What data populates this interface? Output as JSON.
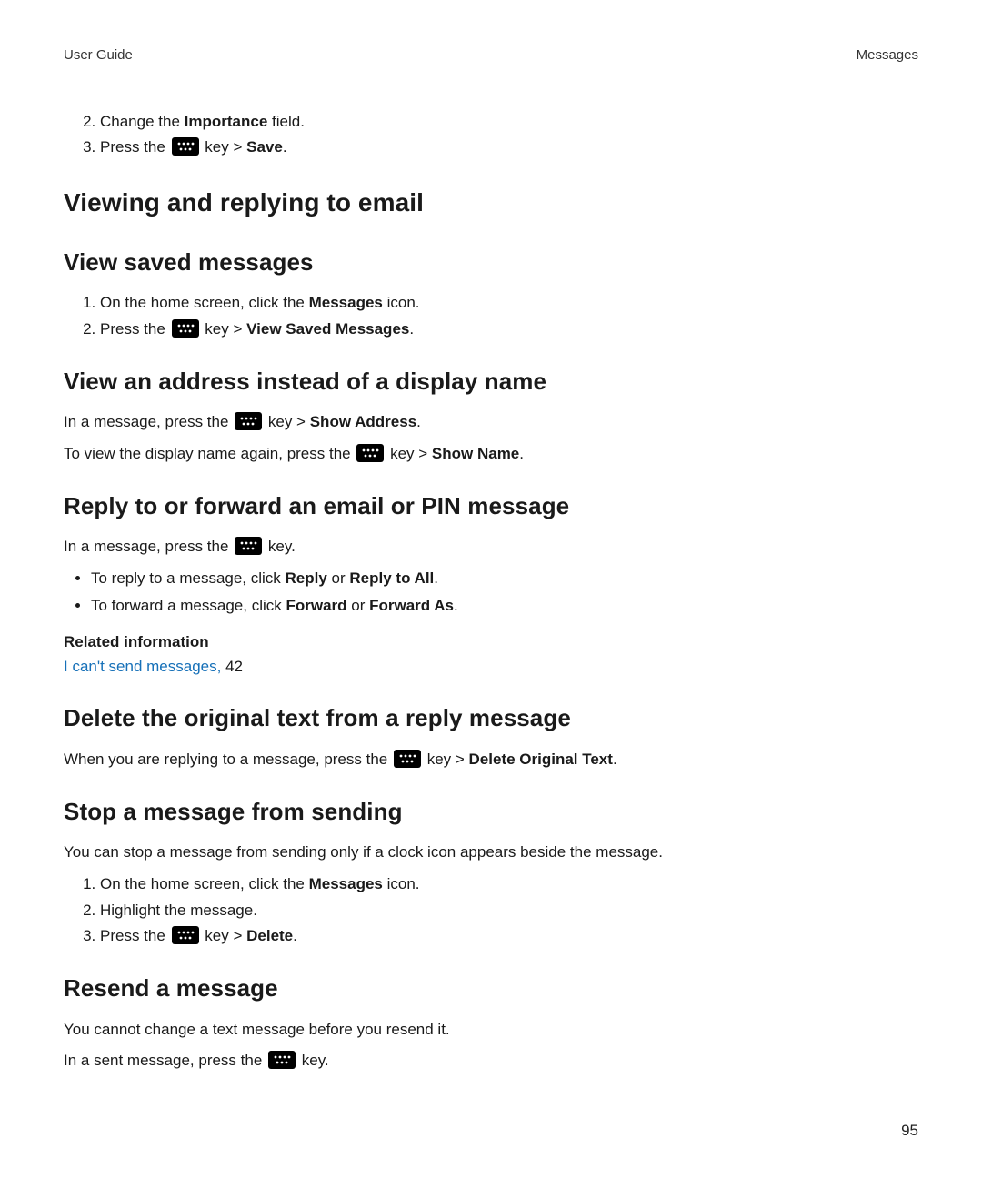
{
  "header": {
    "left": "User Guide",
    "right": "Messages"
  },
  "top_steps": [
    {
      "pre": "Change the ",
      "b1": "Importance",
      "post": " field."
    },
    {
      "pre": "Press the ",
      "key": true,
      "mid": " key > ",
      "b1": "Save",
      "post": "."
    }
  ],
  "h1_viewing": "Viewing and replying to email",
  "h2_view_saved": "View saved messages",
  "view_saved_steps": [
    {
      "pre": "On the home screen, click the ",
      "b1": "Messages",
      "post": " icon."
    },
    {
      "pre": "Press the ",
      "key": true,
      "mid": " key > ",
      "b1": "View Saved Messages",
      "post": "."
    }
  ],
  "h2_view_addr": "View an address instead of a display name",
  "view_addr_p1": {
    "pre": "In a message, press the ",
    "key": true,
    "mid": " key > ",
    "b1": "Show Address",
    "post": "."
  },
  "view_addr_p2": {
    "pre": "To view the display name again, press the ",
    "key": true,
    "mid": " key > ",
    "b1": "Show Name",
    "post": "."
  },
  "h2_reply_fwd": "Reply to or forward an email or PIN message",
  "reply_fwd_intro": {
    "pre": "In a message, press the ",
    "key": true,
    "post": " key."
  },
  "reply_fwd_bullets": [
    {
      "pre": "To reply to a message, click ",
      "b1": "Reply",
      "mid": " or ",
      "b2": "Reply to All",
      "post": "."
    },
    {
      "pre": "To forward a message, click ",
      "b1": "Forward",
      "mid": " or ",
      "b2": "Forward As",
      "post": "."
    }
  ],
  "related_heading": "Related information",
  "related_link": "I can't send messages,",
  "related_page": " 42",
  "h2_delete_orig": "Delete the original text from a reply message",
  "delete_orig_p": {
    "pre": "When you are replying to a message, press the ",
    "key": true,
    "mid": " key > ",
    "b1": "Delete Original Text",
    "post": "."
  },
  "h2_stop_send": "Stop a message from sending",
  "stop_send_intro": "You can stop a message from sending only if a clock icon appears beside the message.",
  "stop_send_steps": [
    {
      "pre": "On the home screen, click the ",
      "b1": "Messages",
      "post": " icon."
    },
    {
      "text": "Highlight the message."
    },
    {
      "pre": "Press the ",
      "key": true,
      "mid": " key > ",
      "b1": "Delete",
      "post": "."
    }
  ],
  "h2_resend": "Resend a message",
  "resend_intro": "You cannot change a text message before you resend it.",
  "resend_p": {
    "pre": "In a sent message, press the ",
    "key": true,
    "post": " key."
  },
  "page_number": "95",
  "icon_label": "menu-key-icon"
}
